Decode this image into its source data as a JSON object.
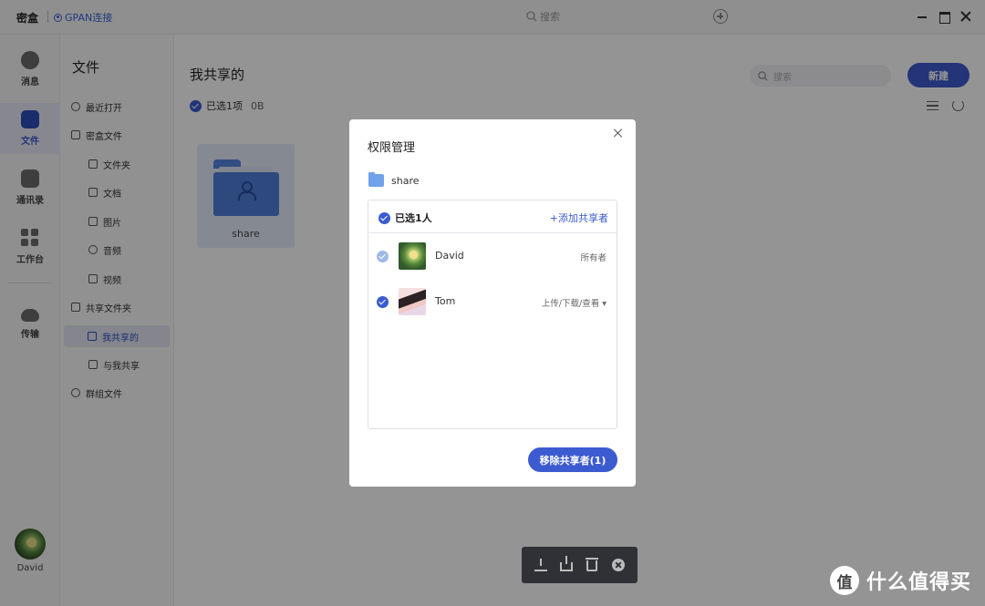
{
  "titlebar": {
    "app_name": "密盒",
    "gpan_link": "GPAN连接",
    "search_placeholder": "搜索"
  },
  "rail": {
    "items": [
      {
        "label": "消息",
        "icon": "message-icon"
      },
      {
        "label": "文件",
        "icon": "file-icon",
        "active": true
      },
      {
        "label": "通讯录",
        "icon": "contacts-icon"
      },
      {
        "label": "工作台",
        "icon": "workbench-icon"
      },
      {
        "label": "传输",
        "icon": "transfer-icon"
      }
    ],
    "user_name": "David"
  },
  "side": {
    "title": "文件",
    "items": [
      {
        "label": "最近打开",
        "icon": "clock-icon"
      },
      {
        "label": "密盒文件",
        "icon": "box-icon"
      },
      {
        "label": "文件夹",
        "icon": "folder-icon"
      },
      {
        "label": "文档",
        "icon": "document-icon"
      },
      {
        "label": "图片",
        "icon": "image-icon"
      },
      {
        "label": "音频",
        "icon": "music-icon"
      },
      {
        "label": "视频",
        "icon": "video-icon"
      },
      {
        "label": "共享文件夹",
        "icon": "shared-folder-icon"
      },
      {
        "label": "我共享的",
        "icon": "folder-icon",
        "active": true
      },
      {
        "label": "与我共享",
        "icon": "folder-icon"
      },
      {
        "label": "群组文件",
        "icon": "group-icon"
      }
    ]
  },
  "main": {
    "title": "我共享的",
    "selected_text": "已选1项",
    "selected_size": "0B",
    "search_placeholder": "搜索",
    "new_button": "新建",
    "folder_name": "share"
  },
  "dialog": {
    "title": "权限管理",
    "folder_name": "share",
    "selected_count": "已选1人",
    "add_sharer": "+添加共享者",
    "members": [
      {
        "name": "David",
        "role": "所有者",
        "checked": true,
        "dimmed": true
      },
      {
        "name": "Tom",
        "role": "上传/下载/查看 ▾",
        "checked": true,
        "dimmed": false
      }
    ],
    "remove_button": "移除共享者(1)"
  },
  "action_bar": {
    "icons": [
      "download-icon",
      "share-icon",
      "delete-icon",
      "close-icon"
    ]
  },
  "watermark": {
    "text": "什么值得买"
  },
  "colors": {
    "accent": "#3d5bd0",
    "overlay": "rgba(0,0,0,0.42)"
  }
}
